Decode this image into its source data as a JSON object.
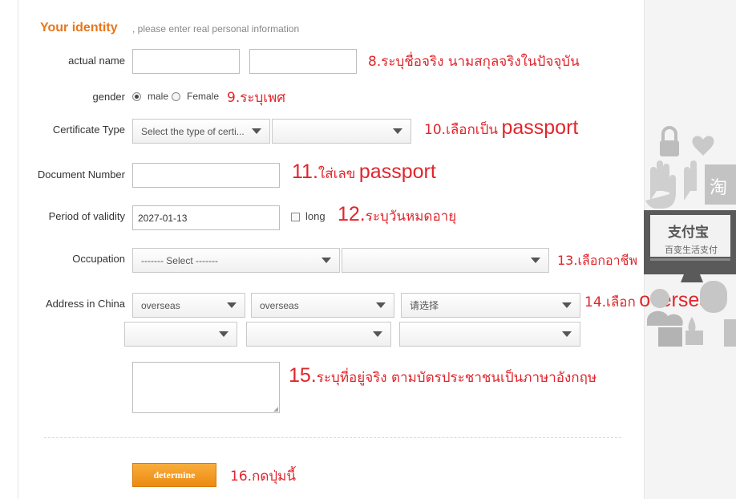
{
  "section": {
    "title": "Your identity",
    "hint": ", please enter real personal information"
  },
  "fields": {
    "actual_name": {
      "label": "actual name"
    },
    "gender": {
      "label": "gender",
      "male": "male",
      "female": "Female"
    },
    "certificate_type": {
      "label": "Certificate Type",
      "select1": "Select the type of certi...",
      "select2": ""
    },
    "document_number": {
      "label": "Document Number"
    },
    "period": {
      "label": "Period of validity",
      "value": "2027-01-13",
      "long_label": "long"
    },
    "occupation": {
      "label": "Occupation",
      "select1": "------- Select -------",
      "select2": ""
    },
    "address": {
      "label": "Address in China",
      "province": "overseas",
      "city": "overseas",
      "district": "请选择",
      "row2_a": "",
      "row2_b": "",
      "row2_c": ""
    }
  },
  "button": {
    "label": "determine"
  },
  "annotations": {
    "a8": "8.ระบุชื่อจริง นามสกุลจริงในปัจจุบัน",
    "a9": "9.ระบุเพศ",
    "a10_prefix": "10.เลือกเป็น",
    "a10_word": "passport",
    "a11_prefix": "11.",
    "a11_mid": "ใส่เลข",
    "a11_word": "passport",
    "a12_prefix": "12.",
    "a12_mid": "ระบุวันหมดอายุ",
    "a13": "13.เลือกอาชีพ",
    "a14_prefix": "14.เลือก",
    "a14_word": "oversea",
    "a15_prefix": "15.",
    "a15_mid": "ระบุที่อยู่จริง ตามบัตรประชาชนเป็นภาษาอังกฤษ",
    "a16": "16.กดปุ่มนี้"
  },
  "ad": {
    "logo": "支付宝",
    "tagline": "百变生活支付",
    "tao": "淘"
  }
}
